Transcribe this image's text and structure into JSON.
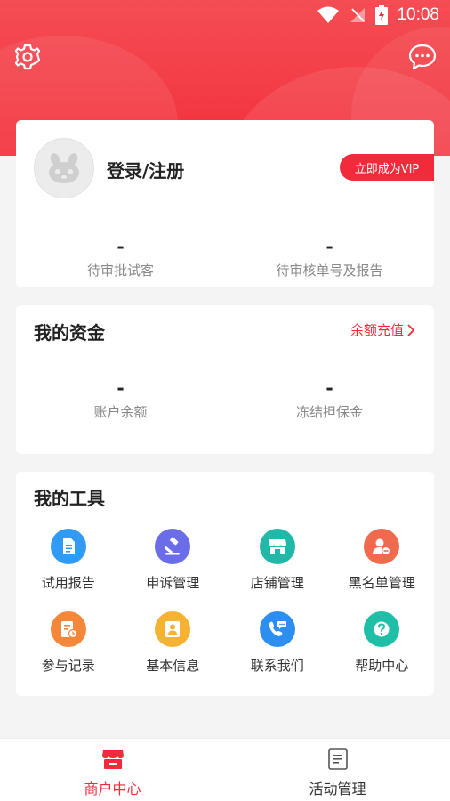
{
  "status_bar": {
    "time": "10:08"
  },
  "colors": {
    "accent": "#f12b3a",
    "header": "#f2303b"
  },
  "header": {
    "left_icon": "settings-gear-icon",
    "right_icon": "chat-message-icon"
  },
  "profile": {
    "login_label": "登录/注册",
    "vip_button": "立即成为VIP",
    "stats": [
      {
        "value": "-",
        "label": "待审批试客"
      },
      {
        "value": "-",
        "label": "待审核单号及报告"
      }
    ]
  },
  "funds": {
    "title": "我的资金",
    "recharge_link": "余额充值",
    "stats": [
      {
        "value": "-",
        "label": "账户余额"
      },
      {
        "value": "-",
        "label": "冻结担保金"
      }
    ]
  },
  "tools": {
    "title": "我的工具",
    "items": [
      {
        "label": "试用报告",
        "icon": "report-document-icon",
        "color": "#2f9bf4"
      },
      {
        "label": "申诉管理",
        "icon": "gavel-icon",
        "color": "#6b6de8"
      },
      {
        "label": "店铺管理",
        "icon": "store-icon",
        "color": "#20b8a7"
      },
      {
        "label": "黑名单管理",
        "icon": "user-block-icon",
        "color": "#f06a4e"
      },
      {
        "label": "参与记录",
        "icon": "record-list-icon",
        "color": "#f5873b"
      },
      {
        "label": "基本信息",
        "icon": "user-profile-icon",
        "color": "#f6b232"
      },
      {
        "label": "联系我们",
        "icon": "phone-chat-icon",
        "color": "#2c8ff0"
      },
      {
        "label": "帮助中心",
        "icon": "help-question-icon",
        "color": "#1fbfa7"
      }
    ]
  },
  "bottom_nav": {
    "items": [
      {
        "label": "商户中心",
        "icon": "merchant-store-icon",
        "active": true
      },
      {
        "label": "活动管理",
        "icon": "activity-list-icon",
        "active": false
      }
    ]
  }
}
